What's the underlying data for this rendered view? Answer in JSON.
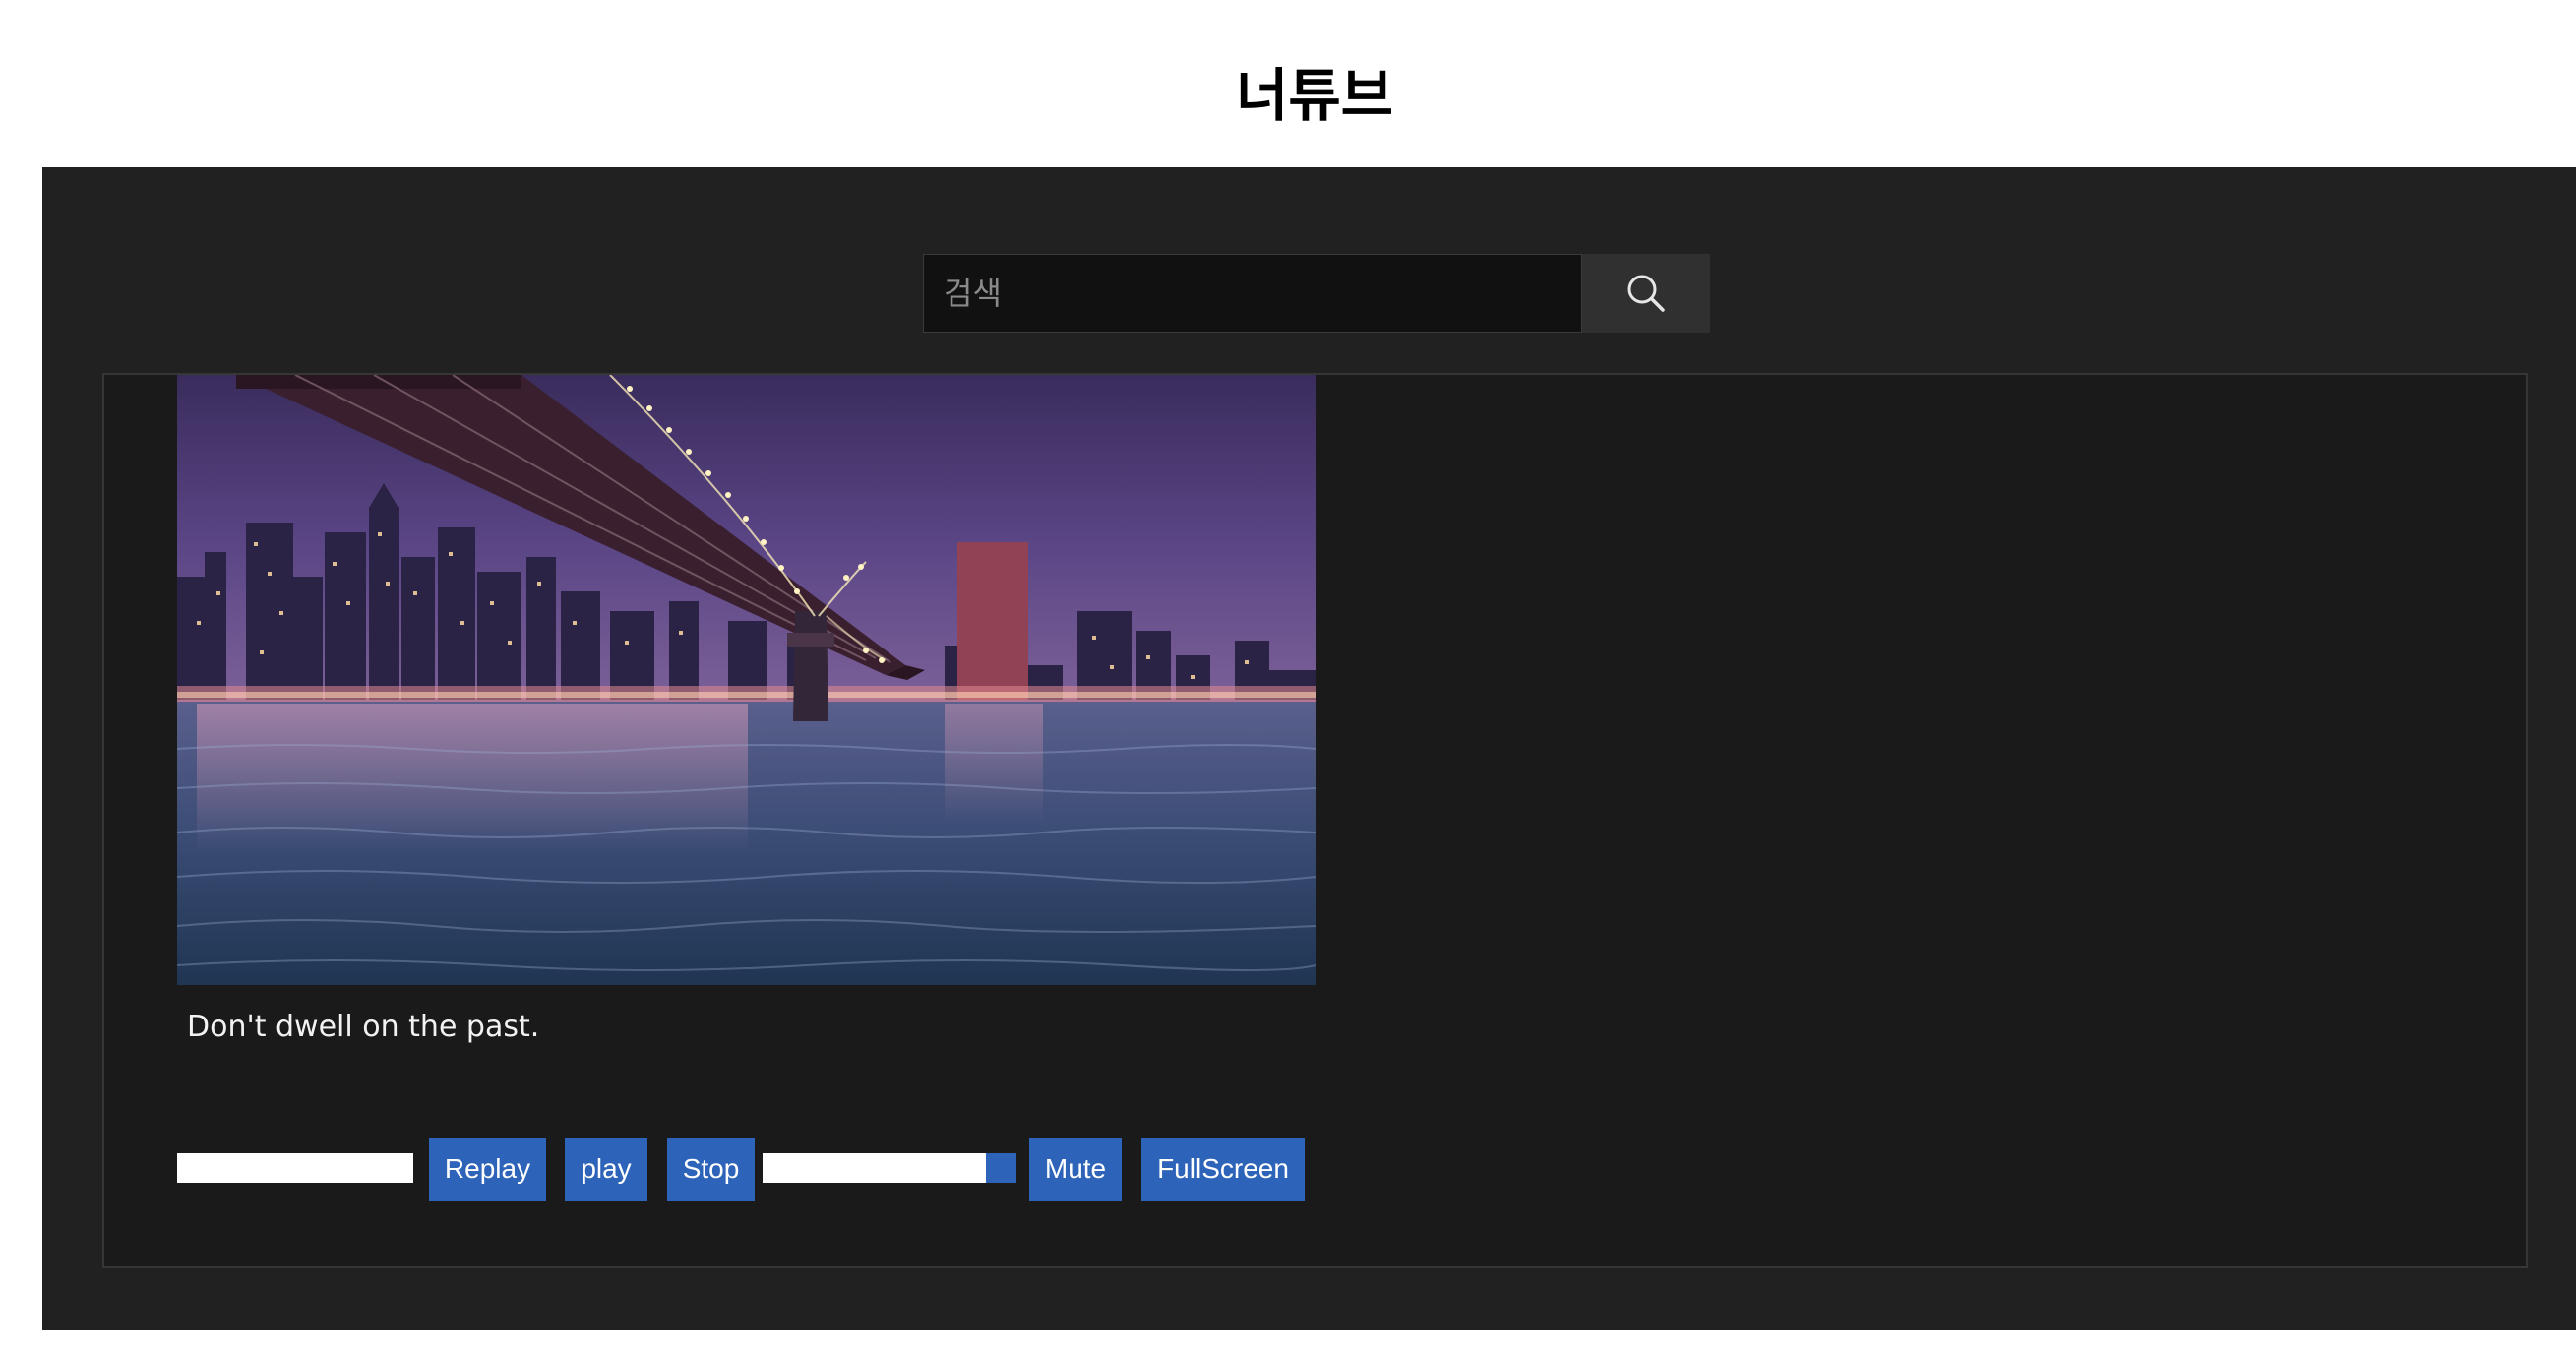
{
  "page": {
    "title": "너튜브"
  },
  "search": {
    "placeholder": "검색",
    "value": "",
    "button_icon": "search-icon"
  },
  "video": {
    "caption": "Don't dwell on the past.",
    "scene": "night city skyline with bridge over river"
  },
  "controls": {
    "progress": 0.0,
    "replay_label": "Replay",
    "play_label": "play",
    "stop_label": "Stop",
    "volume": 0.88,
    "mute_label": "Mute",
    "fullscreen_label": "FullScreen"
  },
  "colors": {
    "page_background": "#ffffff",
    "panel_background": "#212121",
    "player_background": "#1a1a1a",
    "button_blue": "#2d63b8",
    "track_white": "#ffffff"
  }
}
